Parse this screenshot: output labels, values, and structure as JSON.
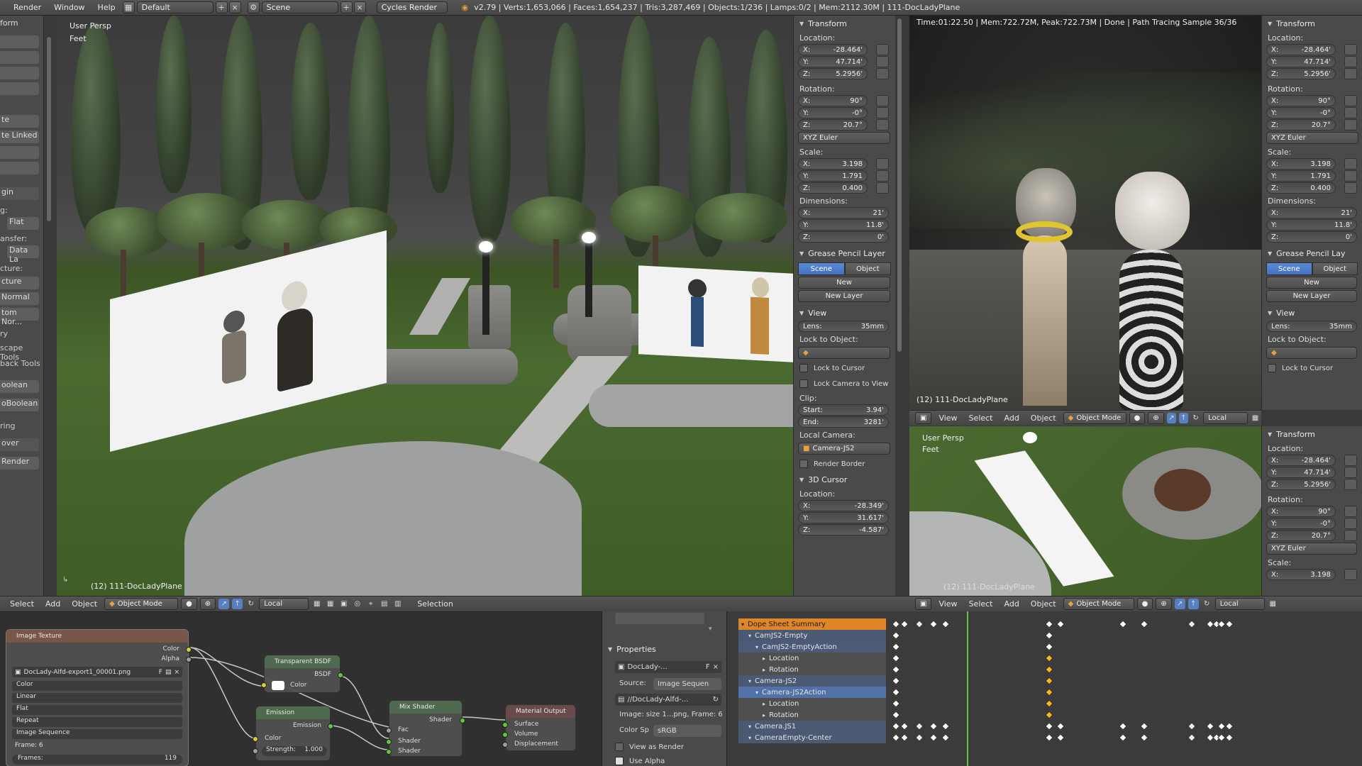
{
  "topbar": {
    "menus": [
      "Render",
      "Window",
      "Help"
    ],
    "screen_layout": "Default",
    "scene": "Scene",
    "engine": "Cycles Render",
    "stats": "v2.79 | Verts:1,653,066 | Faces:1,654,237 | Tris:3,287,469 | Objects:1/236 | Lamps:0/2 | Mem:2112.30M | 111-DocLadyPlane"
  },
  "left_toolshelf": {
    "items": [
      "form",
      "te",
      "te Linked",
      "gin",
      "g:",
      "Flat",
      "ansfer:",
      "Data La",
      "cture:",
      "cture",
      "Normal ...",
      "tom Nor...",
      "ry",
      "scape Tools",
      "back Tools",
      "oolean",
      "oBoolean",
      "ring",
      "over",
      "Render"
    ]
  },
  "main_viewport": {
    "view_label": "User Persp",
    "unit_label": "Feet",
    "object_label": "(12) 111-DocLadyPlane"
  },
  "properties_panel": {
    "transform_title": "Transform",
    "location_label": "Location:",
    "location": [
      {
        "axis": "X:",
        "value": "-28.464'"
      },
      {
        "axis": "Y:",
        "value": "47.714'"
      },
      {
        "axis": "Z:",
        "value": "5.2956'"
      }
    ],
    "rotation_label": "Rotation:",
    "rotation": [
      {
        "axis": "X:",
        "value": "90°"
      },
      {
        "axis": "Y:",
        "value": "-0°"
      },
      {
        "axis": "Z:",
        "value": "20.7°"
      }
    ],
    "rotation_mode": "XYZ Euler",
    "scale_label": "Scale:",
    "scale": [
      {
        "axis": "X:",
        "value": "3.198"
      },
      {
        "axis": "Y:",
        "value": "1.791"
      },
      {
        "axis": "Z:",
        "value": "0.400"
      }
    ],
    "dimensions_label": "Dimensions:",
    "dimensions": [
      {
        "axis": "X:",
        "value": "21'"
      },
      {
        "axis": "Y:",
        "value": "11.8'"
      },
      {
        "axis": "Z:",
        "value": "0'"
      }
    ],
    "grease_pencil_title": "Grease Pencil Layer",
    "gp_scene": "Scene",
    "gp_object": "Object",
    "gp_new": "New",
    "gp_new_layer": "New Layer",
    "view_title": "View",
    "lens": "Lens:",
    "lens_value": "35mm",
    "lock_to_object": "Lock to Object:",
    "lock_to_cursor": "Lock to Cursor",
    "lock_camera": "Lock Camera to View",
    "clip": "Clip:",
    "clip_start": "Start:",
    "clip_start_value": "3.94'",
    "clip_end": "End:",
    "clip_end_value": "3281'",
    "local_camera": "Local Camera:",
    "camera_name": "Camera-JS2",
    "render_border": "Render Border",
    "cursor_title": "3D Cursor",
    "cursor_location_label": "Location:",
    "cursor": [
      {
        "axis": "X:",
        "value": "-28.349'"
      },
      {
        "axis": "Y:",
        "value": "31.617'"
      },
      {
        "axis": "Z:",
        "value": "-4.587'"
      }
    ]
  },
  "render_view": {
    "status": "Time:01:22.50 | Mem:722.72M, Peak:722.73M | Done | Path Tracing Sample 36/36",
    "object_label": "(12) 111-DocLadyPlane"
  },
  "right_panel": {
    "transform_title": "Transform",
    "location_label": "Location:",
    "location": [
      {
        "axis": "X:",
        "value": "-28.464'"
      },
      {
        "axis": "Y:",
        "value": "47.714'"
      },
      {
        "axis": "Z:",
        "value": "5.2956'"
      }
    ],
    "rotation_label": "Rotation:",
    "rotation": [
      {
        "axis": "X:",
        "value": "90°"
      },
      {
        "axis": "Y:",
        "value": "-0°"
      },
      {
        "axis": "Z:",
        "value": "20.7°"
      }
    ],
    "rotation_mode": "XYZ Euler",
    "scale_label": "Scale:",
    "scale": [
      {
        "axis": "X:",
        "value": "3.198"
      },
      {
        "axis": "Y:",
        "value": "1.791"
      },
      {
        "axis": "Z:",
        "value": "0.400"
      }
    ],
    "dimensions_label": "Dimensions:",
    "dimensions": [
      {
        "axis": "X:",
        "value": "21'"
      },
      {
        "axis": "Y:",
        "value": "11.8'"
      },
      {
        "axis": "Z:",
        "value": "0'"
      }
    ],
    "grease_pencil_title": "Grease Pencil Lay",
    "gp_scene": "Scene",
    "gp_object": "Object",
    "gp_new": "New",
    "gp_new_layer": "New Layer",
    "view_title": "View",
    "lens": "Lens:",
    "lens_value": "35mm",
    "lock_to_object": "Lock to Object:",
    "lock_to_cursor": "Lock to Cursor"
  },
  "right_panel_lower": {
    "transform_title": "Transform",
    "location_label": "Location:",
    "location": [
      {
        "axis": "X:",
        "value": "-28.464'"
      },
      {
        "axis": "Y:",
        "value": "47.714'"
      },
      {
        "axis": "Z:",
        "value": "5.2956'"
      }
    ],
    "rotation_label": "Rotation:",
    "rotation": [
      {
        "axis": "X:",
        "value": "90°"
      },
      {
        "axis": "Y:",
        "value": "-0°"
      },
      {
        "axis": "Z:",
        "value": "20.7°"
      }
    ],
    "rotation_mode": "XYZ Euler",
    "scale_label": "Scale:",
    "scale_x": {
      "axis": "X:",
      "value": "3.198"
    }
  },
  "viewport_header": {
    "menus": [
      "View",
      "Select",
      "Add",
      "Object"
    ],
    "mode": "Object Mode",
    "orientation": "Local"
  },
  "main_header": {
    "menus": [
      "Select",
      "Add",
      "Object"
    ],
    "mode": "Object Mode",
    "orientation": "Local",
    "selection_label": "Selection"
  },
  "small_viewport": {
    "view_label": "User Persp",
    "unit_label": "Feet",
    "object_label": "(12) 111-DocLadyPlane"
  },
  "node_editor": {
    "image_texture": {
      "title": "Image Texture",
      "out_color": "Color",
      "out_alpha": "Alpha",
      "image": "DocLady-Alfd-export1_00001.png",
      "image_flag": "F",
      "dropdowns": [
        "Color",
        "Linear",
        "Flat",
        "Repeat",
        "Image Sequence"
      ],
      "frame_label": "Frame: 6",
      "frames_label": "Frames:",
      "frames_value": "119"
    },
    "transparent": {
      "title": "Transparent BSDF",
      "out": "BSDF",
      "in": "Color"
    },
    "emission": {
      "title": "Emission",
      "out": "Emission",
      "in_color": "Color",
      "strength": "Strength:",
      "strength_value": "1.000"
    },
    "mix": {
      "title": "Mix Shader",
      "out": "Shader",
      "fac": "Fac",
      "in1": "Shader",
      "in2": "Shader"
    },
    "output": {
      "title": "Material Output",
      "surface": "Surface",
      "volume": "Volume",
      "displacement": "Displacement"
    }
  },
  "image_props": {
    "title": "Properties",
    "image_name": "DocLady-...",
    "image_flag": "F",
    "source_label": "Source:",
    "source_value": "Image Sequen",
    "filepath": "//DocLady-Alfd-...",
    "info": "Image: size 1...png, Frame: 6",
    "color_space_label": "Color Sp",
    "color_space_value": "sRGB",
    "view_as_render": "View as Render",
    "use_alpha": "Use Alpha"
  },
  "dope_sheet": {
    "rows": [
      {
        "label": "Dope Sheet Summary",
        "level": 0,
        "kind": "summary"
      },
      {
        "label": "CamJS2-Empty",
        "level": 1,
        "kind": "object"
      },
      {
        "label": "CamJS2-EmptyAction",
        "level": 2,
        "kind": "action"
      },
      {
        "label": "Location",
        "level": 3,
        "kind": "group"
      },
      {
        "label": "Rotation",
        "level": 3,
        "kind": "group"
      },
      {
        "label": "Camera-JS2",
        "level": 1,
        "kind": "object"
      },
      {
        "label": "Camera-JS2Action",
        "level": 2,
        "kind": "action-sel"
      },
      {
        "label": "Location",
        "level": 3,
        "kind": "group"
      },
      {
        "label": "Rotation",
        "level": 3,
        "kind": "group"
      },
      {
        "label": "Camera.JS1",
        "level": 1,
        "kind": "object"
      },
      {
        "label": "CameraEmpty-Center",
        "level": 1,
        "kind": "object"
      }
    ]
  },
  "colors": {
    "accent_blue": "#5680c2",
    "summary_orange": "#e0862a",
    "playhead_green": "#5ec83b",
    "keyframe_yellow": "#f3b72b"
  }
}
